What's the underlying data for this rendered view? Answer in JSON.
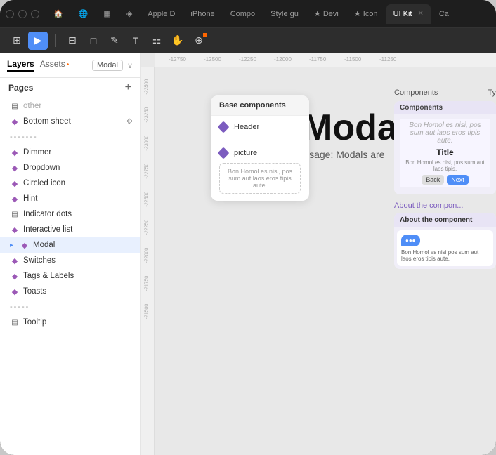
{
  "tabs": {
    "items": [
      {
        "label": "Apple D",
        "active": false
      },
      {
        "label": "iPhone",
        "active": false
      },
      {
        "label": "Compo",
        "active": false
      },
      {
        "label": "Style gu",
        "active": false
      },
      {
        "label": "★ Devi",
        "active": false
      },
      {
        "label": "★ Icon",
        "active": false
      },
      {
        "label": "UI Kit",
        "active": true
      },
      {
        "label": "Ca",
        "active": false
      }
    ]
  },
  "toolbar": {
    "tools": [
      "⊞",
      "▶",
      "⊟",
      "□",
      "✎",
      "T",
      "⚏",
      "✋",
      "⊕"
    ]
  },
  "sidebar": {
    "tabs": [
      {
        "label": "Layers",
        "active": true
      },
      {
        "label": "Assets",
        "active": false,
        "badge": "•"
      }
    ],
    "breadcrumb": "Modal",
    "pages_title": "Pages",
    "add_label": "+",
    "layers": [
      {
        "label": "other",
        "type": "text",
        "depth": 0
      },
      {
        "label": "Bottom sheet",
        "type": "component",
        "depth": 0,
        "badge": "⚙"
      },
      {
        "label": "-------",
        "type": "separator",
        "depth": 0
      },
      {
        "label": "Dimmer",
        "type": "component",
        "depth": 0
      },
      {
        "label": "Dropdown",
        "type": "component",
        "depth": 0
      },
      {
        "label": "Circled icon",
        "type": "component",
        "depth": 0
      },
      {
        "label": "Hint",
        "type": "component",
        "depth": 0
      },
      {
        "label": "Indicator dots",
        "type": "component",
        "depth": 0
      },
      {
        "label": "Interactive list",
        "type": "component",
        "depth": 0
      },
      {
        "label": "Modal",
        "type": "component",
        "depth": 0,
        "expanded": true,
        "selected": true
      },
      {
        "label": "Switches",
        "type": "component",
        "depth": 0
      },
      {
        "label": "Tags & Labels",
        "type": "component",
        "depth": 0
      },
      {
        "label": "Toasts",
        "type": "component",
        "depth": 0
      },
      {
        "label": "-----",
        "type": "separator2",
        "depth": 0
      },
      {
        "label": "Tooltip",
        "type": "component",
        "depth": 0
      }
    ]
  },
  "canvas": {
    "rulers": {
      "top": [
        "-12750",
        "-12500",
        "-12250",
        "-12000",
        "-11750",
        "-11500",
        "-11250"
      ],
      "left": [
        "-23500",
        "-23250",
        "-23000",
        "-22750",
        "-22500",
        "-22250",
        "-22000",
        "-21750",
        "-21500"
      ]
    },
    "modal_title": "Modal",
    "modal_subtitle": "Usage: Modals are",
    "base_components": {
      "header": "Base components",
      "items": [
        {
          "label": ".Header"
        },
        {
          "label": ".picture"
        }
      ],
      "body_text": "Bon Homol es nisi, pos sum aut laos eros tipis aute."
    },
    "right_panel": {
      "components_label": "Components",
      "type_label": "Ty",
      "card": {
        "header": "Components",
        "title": "Title",
        "description": "Bon Homol es nisi, pos sum aut laos tipis.",
        "buttons": [
          "Back",
          "Next"
        ]
      },
      "about_label": "About the compon...",
      "about_card": {
        "label": "About the component",
        "message": "●●●",
        "body_text": "Bon Homol es nisi pos sum aut laos eros tipis aute."
      }
    }
  }
}
